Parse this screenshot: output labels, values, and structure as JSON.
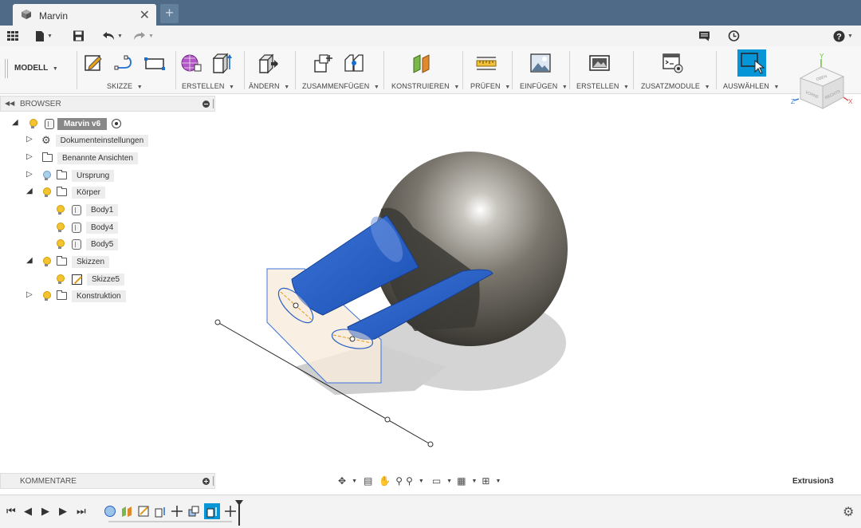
{
  "window": {
    "tab_title": "Marvin",
    "close_glyph": "✕",
    "new_tab_glyph": "+"
  },
  "quickbar": {
    "icons": [
      "app-grid-icon",
      "file-icon",
      "save-icon",
      "undo-icon",
      "redo-icon",
      "comment-icon",
      "history-icon",
      "help-icon"
    ]
  },
  "ribbon": {
    "workspace": "MODELL",
    "groups": {
      "skizze": "SKIZZE",
      "erstellen": "ERSTELLEN",
      "aendern": "ÄNDERN",
      "zusammenfuegen": "ZUSAMMENFÜGEN",
      "konstruieren": "KONSTRUIEREN",
      "pruefen": "PRÜFEN",
      "einfuegen": "EINFÜGEN",
      "erstellen2": "ERSTELLEN",
      "zusatzmodule": "ZUSATZMODULE",
      "auswaehlen": "AUSWÄHLEN"
    }
  },
  "browser": {
    "title": "BROWSER",
    "root": "Marvin v6",
    "items": {
      "doc_settings": "Dokumenteinstellungen",
      "named_views": "Benannte Ansichten",
      "origin": "Ursprung",
      "bodies": "Körper",
      "body1": "Body1",
      "body4": "Body4",
      "body5": "Body5",
      "sketches": "Skizzen",
      "sketch5": "Skizze5",
      "construction": "Konstruktion"
    }
  },
  "comments": {
    "title": "KOMMENTARE"
  },
  "status": {
    "active_feature": "Extrusion3"
  },
  "viewcube": {
    "top": "OBEN",
    "front": "VORNE",
    "right": "RECHTS",
    "axis_x": "X",
    "axis_y": "Y",
    "axis_z": "Z"
  },
  "colors": {
    "titlebar": "#4e6a86",
    "accent": "#0696d7",
    "body_blue": "#2a5fc6",
    "sphere": "#6d6a63"
  }
}
